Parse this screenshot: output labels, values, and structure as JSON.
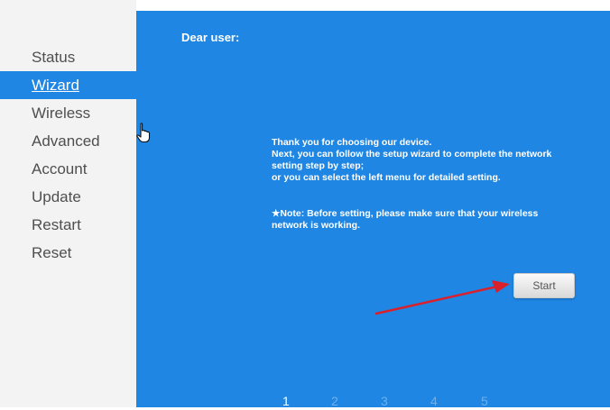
{
  "sidebar": {
    "items": [
      {
        "label": "Status"
      },
      {
        "label": "Wizard",
        "active": true
      },
      {
        "label": "Wireless"
      },
      {
        "label": "Advanced"
      },
      {
        "label": "Account"
      },
      {
        "label": "Update"
      },
      {
        "label": "Restart"
      },
      {
        "label": "Reset"
      }
    ]
  },
  "main": {
    "greeting": "Dear user:",
    "message_lines": [
      "Thank you for choosing our device.",
      "Next, you can follow the setup wizard to complete the network setting step by step;",
      "or you can select the left menu for detailed setting."
    ],
    "note": "★Note: Before setting, please make sure that your wireless network is working.",
    "start_label": "Start",
    "steps": [
      "1",
      "2",
      "3",
      "4",
      "5"
    ],
    "current_step": "1"
  },
  "colors": {
    "accent": "#1f86e3",
    "sidebar_bg": "#f3f3f3",
    "annotation_arrow": "#d9202b"
  },
  "icons": {
    "cursor": "hand-pointer-icon",
    "annotation": "red-arrow-icon"
  }
}
